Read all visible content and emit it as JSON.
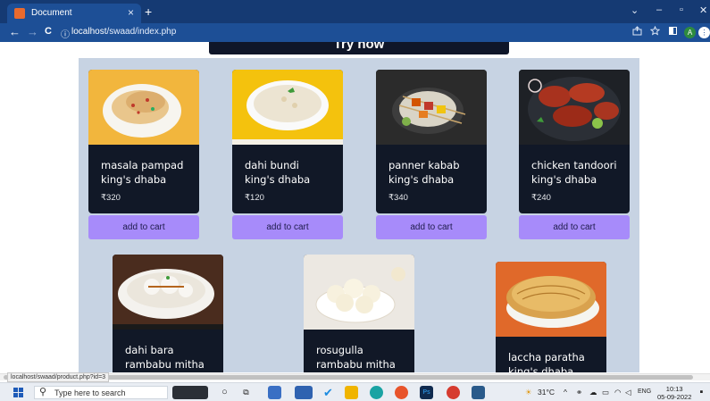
{
  "browser": {
    "tab_title": "Document",
    "tab_close": "×",
    "new_tab": "+",
    "url_host": "localhost",
    "url_path": "/swaad/index.php",
    "window_controls": [
      "⌄",
      "–",
      "▫",
      "✕"
    ],
    "nav": {
      "back": "←",
      "forward": "→",
      "reload": "C",
      "info": "ⓘ"
    },
    "toolbar_icons": [
      "share-icon",
      "star-icon",
      "sidebar-icon"
    ],
    "profile_letter": "A"
  },
  "page": {
    "heading": "Try now",
    "products": [
      {
        "name": "masala pampad",
        "shop": "king's dhaba",
        "price": "₹320",
        "cart_label": "add to cart"
      },
      {
        "name": "dahi bundi",
        "shop": "king's dhaba",
        "price": "₹120",
        "cart_label": "add to cart"
      },
      {
        "name": "panner kabab",
        "shop": "king's dhaba",
        "price": "₹340",
        "cart_label": "add to cart"
      },
      {
        "name": "chicken tandoori",
        "shop": "king's dhaba",
        "price": "₹240",
        "cart_label": "add to cart"
      },
      {
        "name": "dahi bara",
        "shop": "rambabu mitha"
      },
      {
        "name": "rosugulla",
        "shop": "rambabu mitha"
      },
      {
        "name": "laccha paratha",
        "shop": "king's dhaba"
      }
    ]
  },
  "status_link": "localhost/swaad/product.php?id=3",
  "taskbar": {
    "search_placeholder": "Type here to search",
    "weather": "31°C",
    "language": "ENG",
    "time": "10:13",
    "date": "05-09-2022"
  },
  "colors": {
    "chrome_dark": "#153a73",
    "chrome": "#1d4f96",
    "panel": "#c7d3e3",
    "card": "#111827",
    "cart_button": "#a78bfa"
  }
}
